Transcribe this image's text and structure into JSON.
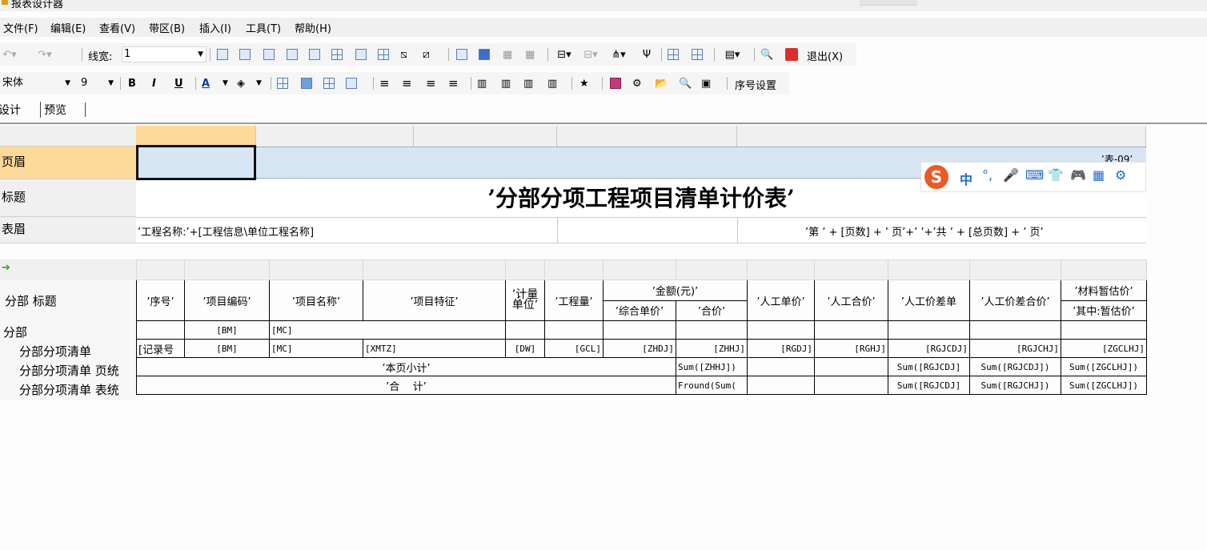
{
  "window": {
    "title": "报表设计器"
  },
  "menu": [
    "文件(F)",
    "编辑(E)",
    "查看(V)",
    "带区(B)",
    "插入(I)",
    "工具(T)",
    "帮助(H)"
  ],
  "toolbar1": {
    "line_width_label": "线宽:",
    "line_width_value": "1",
    "exit_label": "退出(X)"
  },
  "toolbar2": {
    "font_name": "宋体",
    "font_size": "9",
    "bold": "B",
    "italic": "I",
    "underline": "U",
    "font_color": "A",
    "star": "★",
    "seq_label": "序号设置"
  },
  "tabs": [
    "设计",
    "预览"
  ],
  "bands_top": [
    "页眉",
    "标题",
    "表眉"
  ],
  "report": {
    "page_header_right": "’表-09’",
    "title": "’分部分项工程项目清单计价表’",
    "project_name": "’工程名称:’+[工程信息\\单位工程名称]",
    "page_info": "’第 ’ + [页数] + ’ 页’+’ ’+’共 ’ + [总页数] + ’ 页’"
  },
  "bands_bottom": [
    "分部 标题",
    "分部",
    "分部分项清单",
    "分部分项清单 页统",
    "分部分项清单 表统"
  ],
  "columns": {
    "seq": "’序号’",
    "code": "’项目编码’",
    "name": "’项目名称’",
    "feature": "’项目特征’",
    "unit": "’计量单位’",
    "qty": "’工程量’",
    "amount": "’金额(元)’",
    "unit_price": "’综合单价’",
    "total": "’合价’",
    "labor_unit": "’人工单价’",
    "labor_total": "’人工合价’",
    "labor_diff": "’人工价差单",
    "labor_diff_total": "’人工价差合价’",
    "material_est": "’材料暂估价’",
    "material_est_sub": "’其中:暂估价’"
  },
  "rows": {
    "division": {
      "code": "[BM]",
      "name": "[MC]"
    },
    "item": [
      "[记录号",
      "[BM]",
      "[MC]",
      "[XMTZ]",
      "[DW]",
      "[GCL]",
      "[ZHDJ]",
      "[ZHHJ]",
      "[RGDJ]",
      "[RGHJ]",
      "[RGJCDJ]",
      "[RGJCHJ]",
      "[ZGCLHJ]"
    ],
    "page_sum": {
      "label": "’本页小计’",
      "total": "Sum([ZHHJ])",
      "labor_diff": "Sum([RGJCDJ]",
      "labor_diff_total": "Sum([RGJCDJ])",
      "material": "Sum([ZGCLHJ])"
    },
    "grand_sum": {
      "label": "’合    计’",
      "total": "Fround(Sum(",
      "labor_diff": "Sum([RGJCDJ]",
      "labor_diff_total": "Sum([RGJCHJ])",
      "material": "Sum([ZGCLHJ])"
    }
  },
  "ime": {
    "label": "中"
  }
}
